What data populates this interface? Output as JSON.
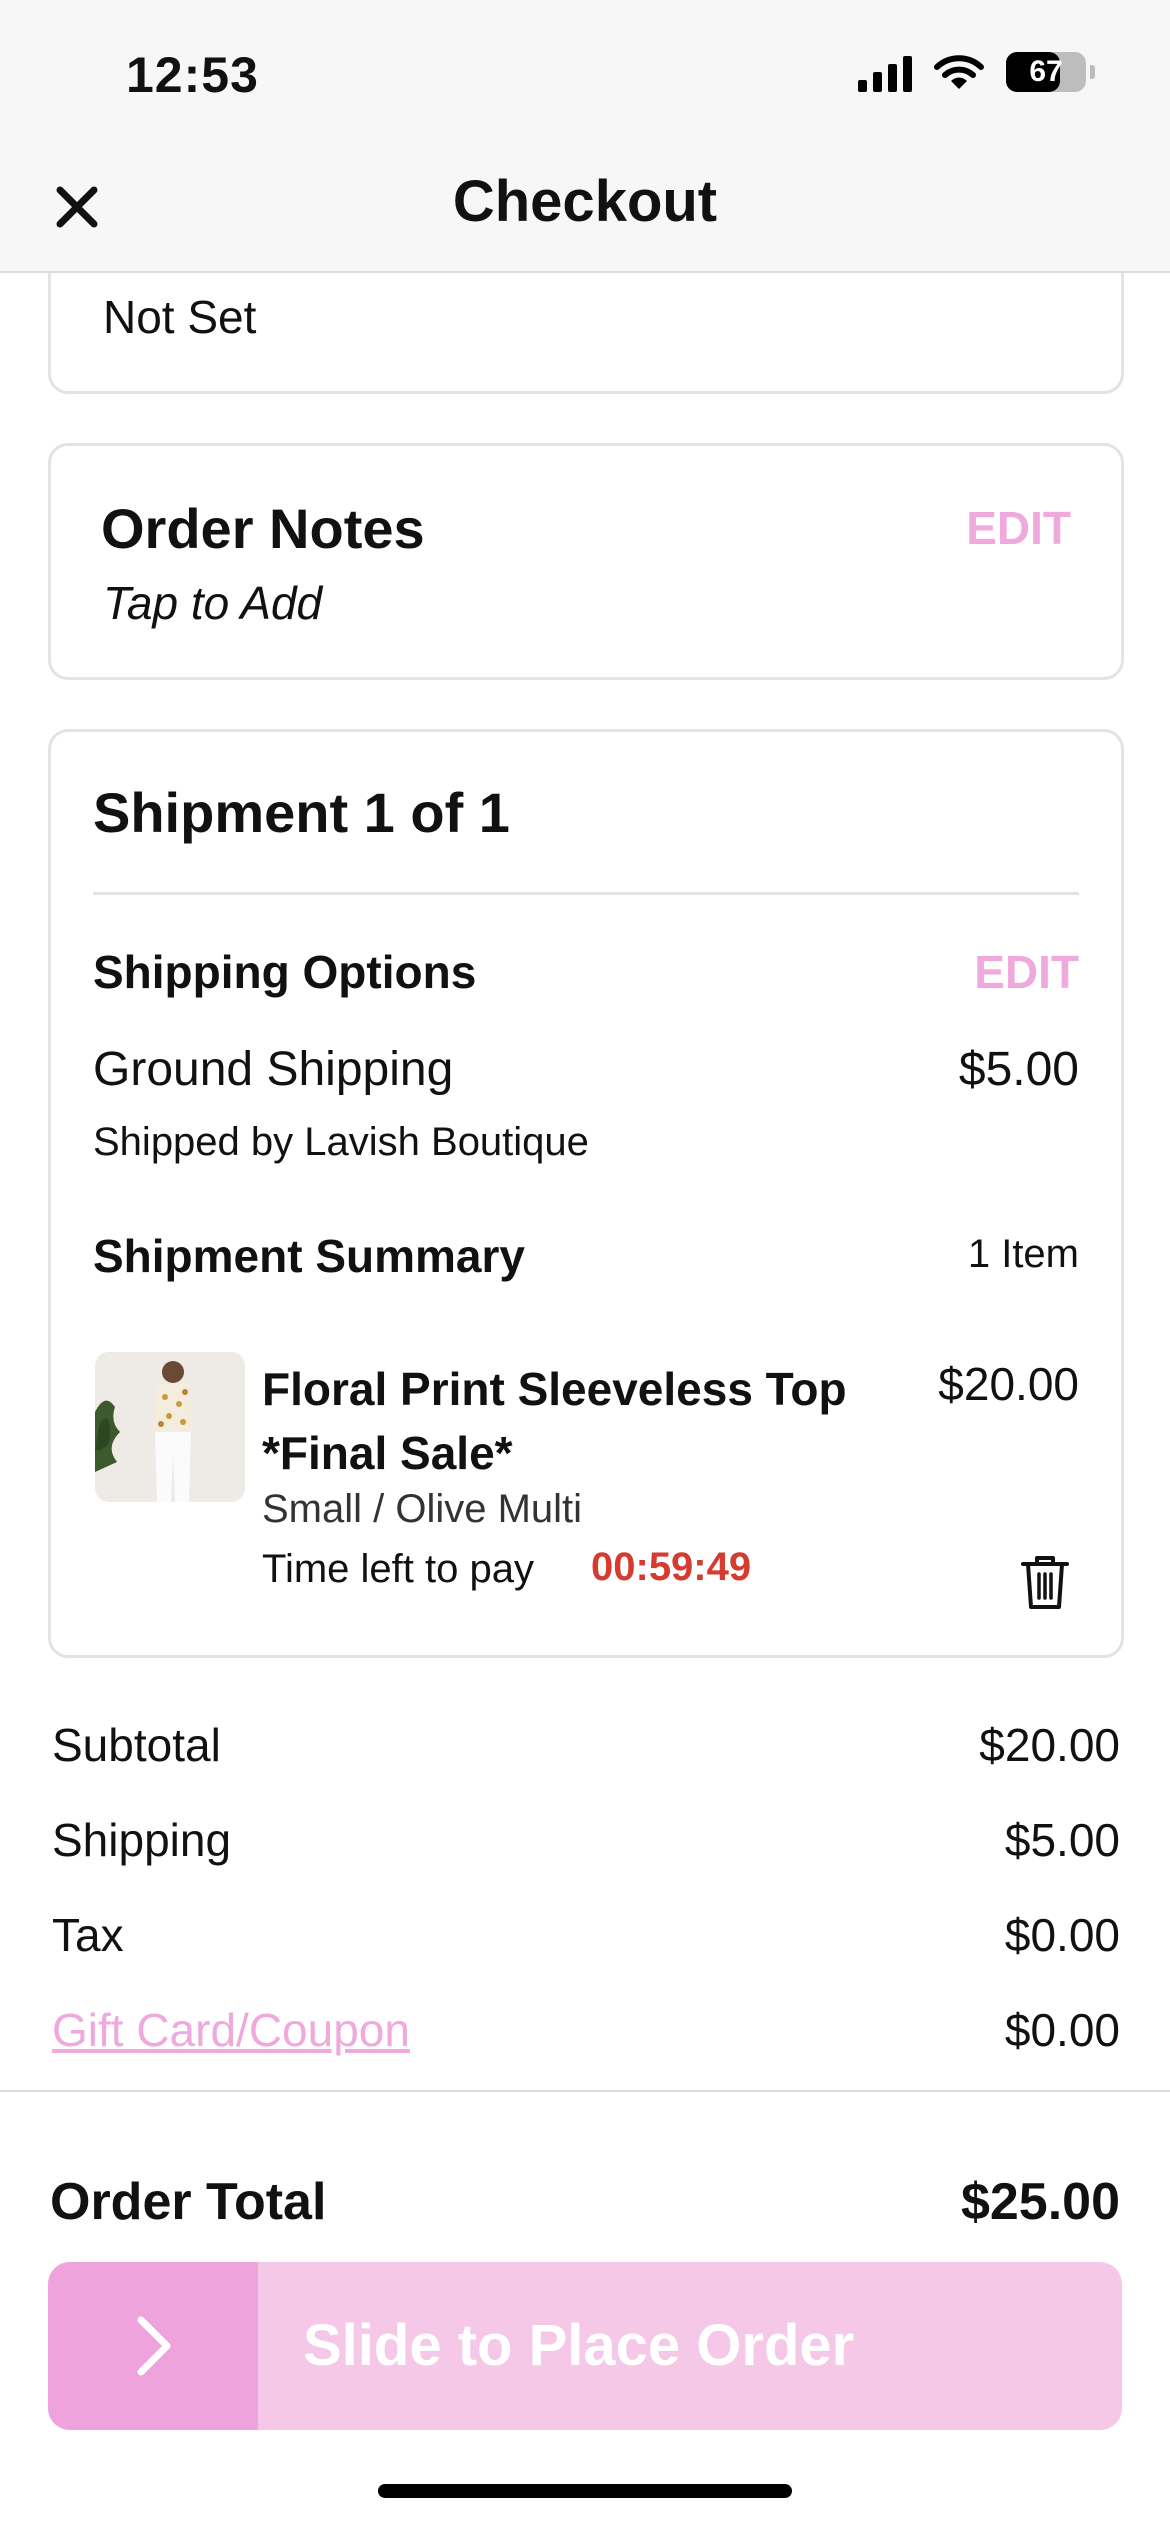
{
  "status_bar": {
    "time": "12:53",
    "battery": "67",
    "battery_level": 0.67
  },
  "header": {
    "title": "Checkout"
  },
  "top_card": {
    "value": "Not Set"
  },
  "order_notes": {
    "title": "Order Notes",
    "hint": "Tap to Add",
    "edit_label": "EDIT"
  },
  "shipment": {
    "title": "Shipment 1 of 1",
    "options_label": "Shipping Options",
    "edit_label": "EDIT",
    "method": "Ground Shipping",
    "method_price": "$5.00",
    "shipped_by": "Shipped by Lavish Boutique",
    "summary_label": "Shipment Summary",
    "item_count": "1 Item",
    "item": {
      "name": "Floral Print Sleeveless Top *Final Sale*",
      "price": "$20.00",
      "variant": "Small / Olive Multi",
      "timer_label": "Time left to pay",
      "timer_value": "00:59:49"
    }
  },
  "totals": {
    "subtotal_label": "Subtotal",
    "subtotal": "$20.00",
    "shipping_label": "Shipping",
    "shipping": "$5.00",
    "tax_label": "Tax",
    "tax": "$0.00",
    "coupon_label": "Gift Card/Coupon",
    "coupon": "$0.00"
  },
  "order_total": {
    "label": "Order Total",
    "value": "$25.00"
  },
  "place_order": {
    "label": "Slide to Place Order"
  },
  "colors": {
    "accent_pink": "#efa9dc",
    "slider_bg": "#f5c8e8",
    "timer_red": "#d63b2f"
  },
  "icons": {
    "close": "close-icon",
    "trash": "trash-icon",
    "chevron": "chevron-right-icon"
  }
}
